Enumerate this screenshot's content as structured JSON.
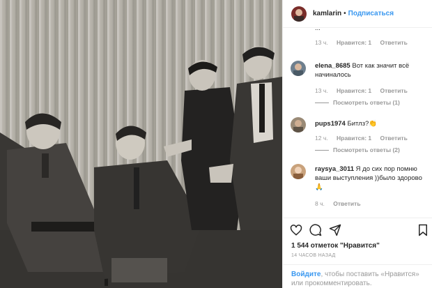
{
  "post": {
    "author": "kamlarin",
    "separator": "•",
    "follow_label": "Подписаться"
  },
  "comments": [
    {
      "username": "",
      "text": "...",
      "time": "13 ч.",
      "like_label": "Нравится: 1",
      "reply_label": "Ответить",
      "partial": true
    },
    {
      "username": "elena_8685",
      "text": "Вот как значит всё начиналось",
      "time": "13 ч.",
      "like_label": "Нравится: 1",
      "reply_label": "Ответить",
      "replies_label": "Посмотреть ответы (1)"
    },
    {
      "username": "pups1974",
      "text": "Битлз?",
      "emoji": "👏",
      "time": "12 ч.",
      "like_label": "Нравится: 1",
      "reply_label": "Ответить",
      "replies_label": "Посмотреть ответы (2)"
    },
    {
      "username": "raysya_3011",
      "text": "Я до сих пор помню ваши выступления ))было здорово",
      "emoji": "🙏",
      "time": "8 ч.",
      "reply_label": "Ответить"
    }
  ],
  "actions": {
    "likes_text": "1 544 отметок \"Нравится\"",
    "time_ago": "14 ЧАСОВ НАЗАД",
    "login_link": "Войдите",
    "login_rest": ", чтобы поставить «Нравится» или прокомментировать."
  },
  "icons": [
    "heart-icon",
    "comment-icon",
    "share-icon",
    "bookmark-icon"
  ],
  "colors": {
    "link": "#3897f0",
    "muted": "#999999",
    "text": "#262626",
    "border": "#efefef"
  }
}
